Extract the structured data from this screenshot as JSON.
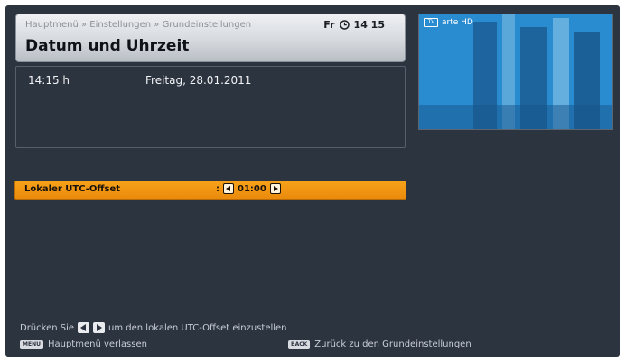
{
  "header": {
    "breadcrumb": "Hauptmenü » Einstellungen » Grundeinstellungen",
    "day": "Fr",
    "time": "14 15",
    "title": "Datum und Uhrzeit"
  },
  "info": {
    "time": "14:15 h",
    "date": "Freitag, 28.01.2011"
  },
  "preview": {
    "icon": "tv-icon",
    "icon_text": "TV",
    "channel": "arte HD"
  },
  "utc_row": {
    "label": "Lokaler UTC-Offset",
    "separator": ":",
    "value": "01:00"
  },
  "footer": {
    "hint_before": "Drücken Sie",
    "hint_after": "um den lokalen UTC-Offset einzustellen",
    "menu_key": "MENU",
    "menu_label": "Hauptmenü verlassen",
    "back_key": "BACK",
    "back_label": "Zurück zu den Grundeinstellungen"
  },
  "colors": {
    "background": "#2c3440",
    "highlight": "#f39a14",
    "text": "#f2f3f5"
  }
}
